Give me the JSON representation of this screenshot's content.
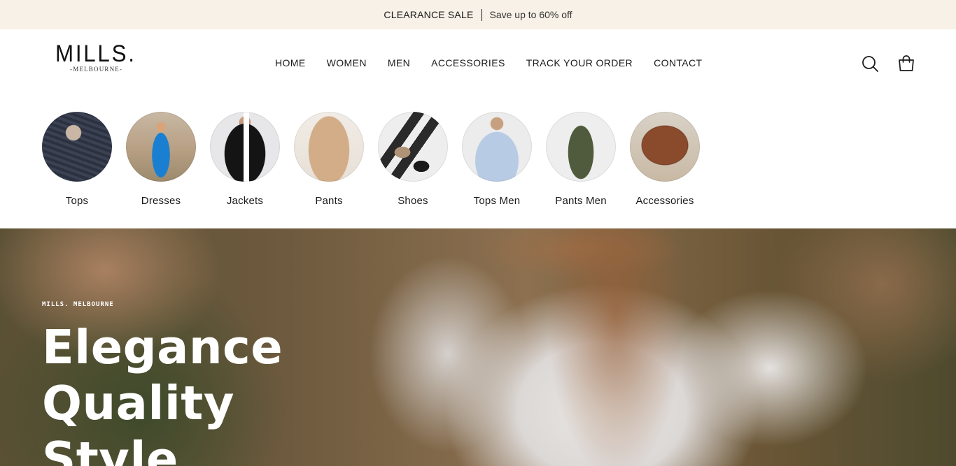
{
  "announcement": {
    "highlight": "CLEARANCE SALE",
    "message": "Save up to 60% off"
  },
  "header": {
    "logo_main": "MILLS.",
    "logo_sub": "-MELBOURNE-",
    "nav": [
      "HOME",
      "WOMEN",
      "MEN",
      "ACCESSORIES",
      "TRACK YOUR ORDER",
      "CONTACT"
    ],
    "icons": [
      "search-icon",
      "shopping-bag-icon"
    ]
  },
  "categories": [
    {
      "label": "Tops"
    },
    {
      "label": "Dresses"
    },
    {
      "label": "Jackets"
    },
    {
      "label": "Pants"
    },
    {
      "label": "Shoes"
    },
    {
      "label": "Tops Men"
    },
    {
      "label": "Pants Men"
    },
    {
      "label": "Accessories"
    }
  ],
  "hero": {
    "eyebrow": "MILLS. MELBOURNE",
    "headline": [
      "Elegance",
      "Quality",
      "Style"
    ]
  }
}
